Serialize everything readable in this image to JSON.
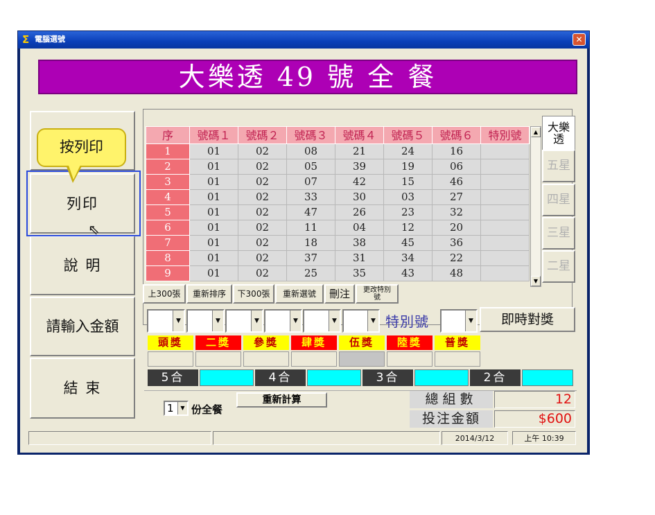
{
  "window": {
    "title": "電腦選號",
    "close": "✕"
  },
  "banner": "大樂透 49 號 全 餐",
  "left_buttons": [
    "列印",
    "說 明",
    "請輸入金額",
    "結 束"
  ],
  "tooltip": "按列印",
  "grid": {
    "headers": [
      "序",
      "號碼１",
      "號碼２",
      "號碼３",
      "號碼４",
      "號碼５",
      "號碼６",
      "特別號"
    ],
    "rows": [
      [
        "1",
        "01",
        "02",
        "08",
        "21",
        "24",
        "16",
        ""
      ],
      [
        "2",
        "01",
        "02",
        "05",
        "39",
        "19",
        "06",
        ""
      ],
      [
        "3",
        "01",
        "02",
        "07",
        "42",
        "15",
        "46",
        ""
      ],
      [
        "4",
        "01",
        "02",
        "33",
        "30",
        "03",
        "27",
        ""
      ],
      [
        "5",
        "01",
        "02",
        "47",
        "26",
        "23",
        "32",
        ""
      ],
      [
        "6",
        "01",
        "02",
        "11",
        "04",
        "12",
        "20",
        ""
      ],
      [
        "7",
        "01",
        "02",
        "18",
        "38",
        "45",
        "36",
        ""
      ],
      [
        "8",
        "01",
        "02",
        "37",
        "31",
        "34",
        "22",
        ""
      ],
      [
        "9",
        "01",
        "02",
        "25",
        "35",
        "43",
        "48",
        ""
      ]
    ]
  },
  "side_tabs": {
    "active": "大樂\n透",
    "items": [
      "五星",
      "四星",
      "三星",
      "二星"
    ]
  },
  "toolbar": [
    "上300張",
    "重新排序",
    "下300張",
    "重新選號",
    "刪注",
    "更改特別\n號"
  ],
  "special_label": "特別號",
  "check_button": "即時對獎",
  "prizes": [
    {
      "label": "頭獎",
      "bg": "#ffff00",
      "fg": "#c00000"
    },
    {
      "label": "二獎",
      "bg": "#ff0000",
      "fg": "#ffff00"
    },
    {
      "label": "參獎",
      "bg": "#ffff00",
      "fg": "#c00000"
    },
    {
      "label": "肆獎",
      "bg": "#ff0000",
      "fg": "#ffff00"
    },
    {
      "label": "伍獎",
      "bg": "#ffff00",
      "fg": "#c00000"
    },
    {
      "label": "陸獎",
      "bg": "#ff0000",
      "fg": "#ffff00"
    },
    {
      "label": "普獎",
      "bg": "#ffff00",
      "fg": "#c00000"
    }
  ],
  "match_labels": [
    "5合",
    "4合",
    "3合",
    "2合"
  ],
  "set_count": "1",
  "set_label": "份全餐",
  "recalc": "重新計算",
  "totals": {
    "groups_label": "總組數",
    "groups_value": "12",
    "amount_label": "投注金額",
    "amount_value": "$600"
  },
  "status": {
    "date": "2014/3/12",
    "time": "上午 10:39"
  }
}
